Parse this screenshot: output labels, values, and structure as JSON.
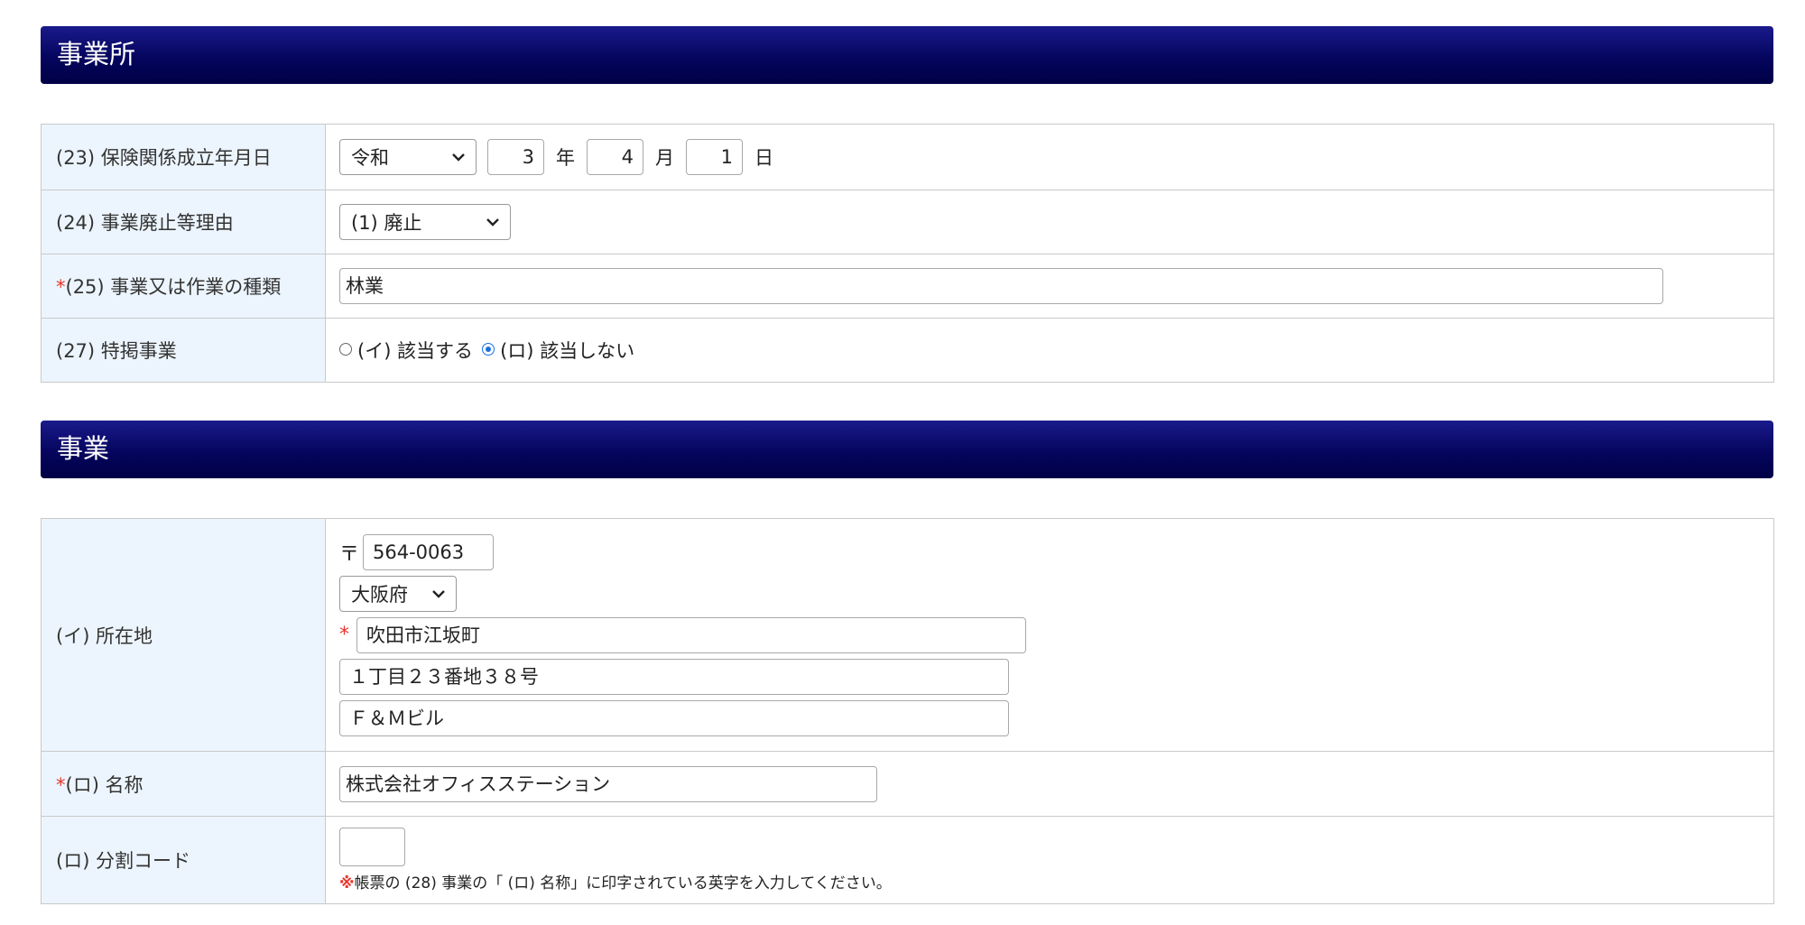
{
  "section1": {
    "title": "事業所",
    "rows": {
      "established_date": {
        "label": "(23) 保険関係成立年月日",
        "era": "令和",
        "year": "3",
        "year_unit": "年",
        "month": "4",
        "month_unit": "月",
        "day": "1",
        "day_unit": "日"
      },
      "abolition_reason": {
        "label": "(24) 事業廃止等理由",
        "value": "(1) 廃止"
      },
      "business_type": {
        "required_mark": "*",
        "label": "(25) 事業又は作業の種類",
        "value": "林業"
      },
      "specific_business": {
        "label": "(27) 特掲事業",
        "option_yes": "(イ) 該当する",
        "option_no": "(ロ) 該当しない",
        "selected": "option_no"
      }
    }
  },
  "section2": {
    "title": "事業",
    "rows": {
      "location": {
        "label": "(イ) 所在地",
        "postal_mark": "〒",
        "postal_code": "564-0063",
        "prefecture": "大阪府",
        "required_mark": "*",
        "city": "吹田市江坂町",
        "address1": "１丁目２３番地３８号",
        "address2": "Ｆ＆Ｍビル"
      },
      "name": {
        "required_mark": "*",
        "label": "(ロ) 名称",
        "value": "株式会社オフィスステーション"
      },
      "division_code": {
        "label": "(ロ) 分割コード",
        "value": "",
        "note_mark": "※",
        "note": "帳票の (28) 事業の「 (ロ) 名称」に印字されている英字を入力してください。"
      }
    }
  },
  "colors": {
    "header_bg": "#000046",
    "label_bg": "#ecf5fd",
    "required": "#e8352b",
    "radio_selected": "#1a6fe0"
  }
}
